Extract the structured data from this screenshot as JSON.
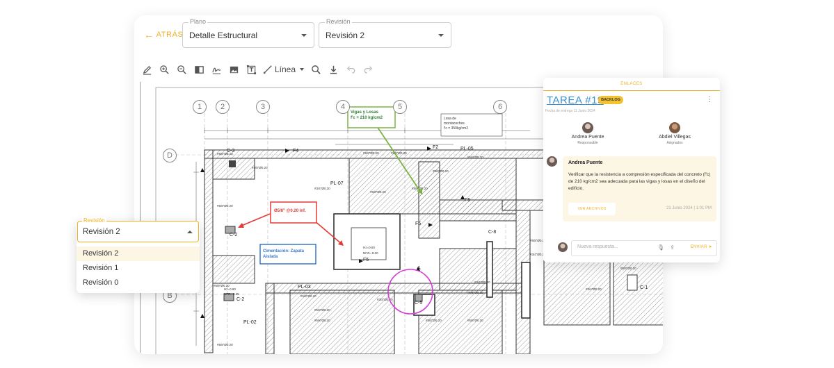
{
  "toolbar": {
    "back_label": "ATRÁS",
    "plano": {
      "label": "Plano",
      "value": "Detalle Estructural"
    },
    "revision": {
      "label": "Revisión",
      "value": "Revisión 2"
    },
    "line_tool_label": "Línea",
    "icons": [
      "pen-icon",
      "zoom-in-icon",
      "zoom-out-icon",
      "compare-icon",
      "signature-icon",
      "image-icon",
      "text-box-icon",
      "line-icon",
      "search-icon",
      "download-icon",
      "undo-icon",
      "redo-icon"
    ]
  },
  "drawing": {
    "grid_columns": [
      "1",
      "2",
      "3",
      "4",
      "5",
      "6"
    ],
    "grid_rows": [
      "D",
      "B"
    ],
    "annotations": {
      "vigas": [
        "Vigas y Losas",
        "f'c = 210 kg/cm2"
      ],
      "losa": [
        "Losa de",
        "montacoches",
        "f'c  =  350kg/cm2"
      ],
      "acero": "Ø5/8\" @0.20 inf.",
      "cimentacion": [
        "Cimentación: Zapata",
        "Aislada"
      ]
    },
    "labels": {
      "c3": "C-3",
      "f4a": "F4",
      "c2a": "C-2",
      "pl07": "PL-07",
      "c2b": "C-2",
      "pl03": "PL-03",
      "pl02": "PL-02",
      "c5": "C-5",
      "c8": "C-8",
      "c1": "C-1",
      "pl05": "PL-05",
      "f2": "F2",
      "f5a": "F5",
      "f5b": "F5",
      "f6": "F6",
      "a": "A"
    },
    "colors": {
      "green": "#7cb342",
      "red": "#e53935",
      "blue": "#3a78c9",
      "magenta": "#d63cd6"
    }
  },
  "revision_dropdown": {
    "label": "Revisión",
    "value": "Revisión 2",
    "options": [
      "Revisión 2",
      "Revisión 1",
      "Revisión 0"
    ]
  },
  "task": {
    "tab": "ENLACES",
    "title": "TAREA #19",
    "badge": "BACKLOG",
    "date": "Fecha de entrega 11 Junio 2024",
    "people": [
      {
        "name": "Andrea Puente",
        "role": "Responsable"
      },
      {
        "name": "Abdiel Villegas",
        "role": "Asignados"
      }
    ],
    "comment": {
      "author": "Andrea Puente",
      "text": "Verificar que la resistencia a compresión especificada del concreto (f'c) de 210 kg/cm2 sea adecuada para las vigas y losas en el diseño del edificio.",
      "button": "VER ARCHIVOS",
      "time": "21 Junio 2024 | 1:01 PM"
    },
    "reply_placeholder": "Nueva respuesta...",
    "send_label": "ENVIAR"
  },
  "accent": "#f2b01e"
}
